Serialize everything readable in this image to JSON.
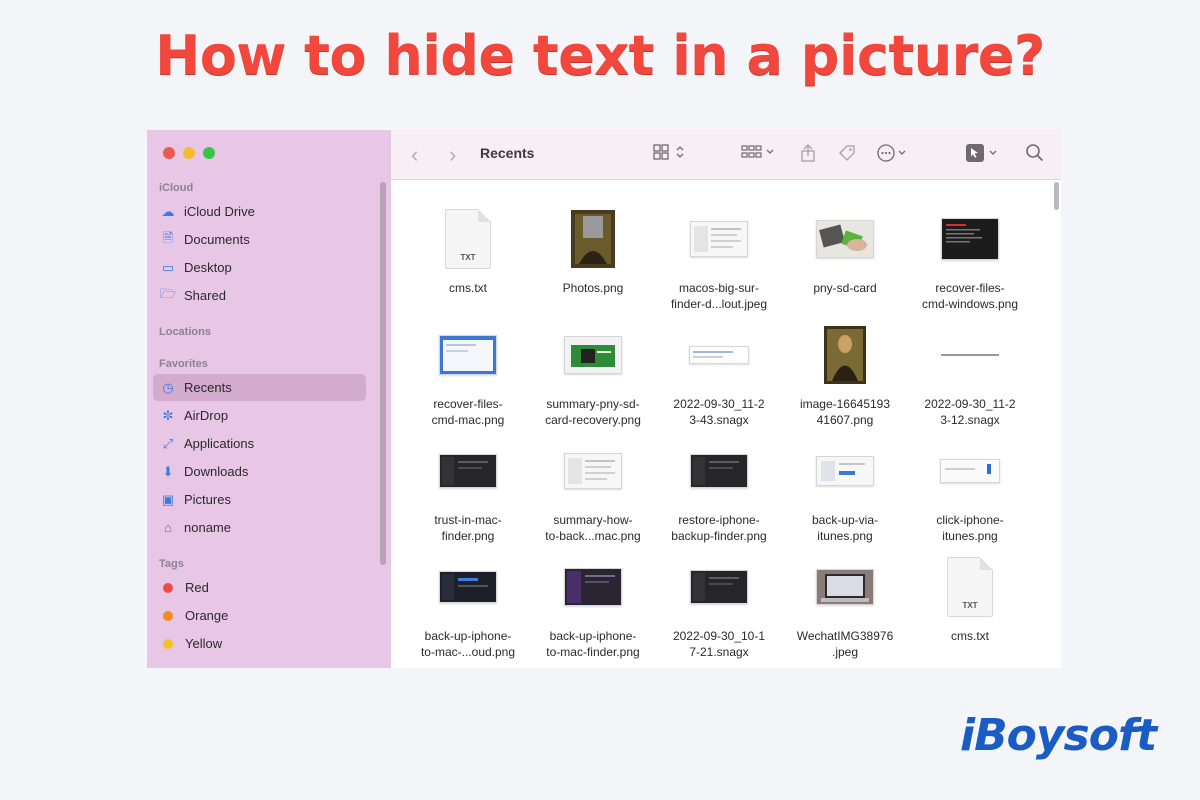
{
  "headline": "How to hide text in a picture?",
  "brand": "iBoysoft",
  "sidebar": {
    "sections": {
      "icloud": "iCloud",
      "locations": "Locations",
      "favorites": "Favorites",
      "tags": "Tags"
    },
    "icloud_items": [
      {
        "label": "iCloud Drive",
        "icon": "cloud-icon"
      },
      {
        "label": "Documents",
        "icon": "document-icon"
      },
      {
        "label": "Desktop",
        "icon": "desktop-icon"
      },
      {
        "label": "Shared",
        "icon": "shared-folder-icon"
      }
    ],
    "favorite_items": [
      {
        "label": "Recents",
        "icon": "clock-icon",
        "active": true
      },
      {
        "label": "AirDrop",
        "icon": "airdrop-icon"
      },
      {
        "label": "Applications",
        "icon": "applications-icon"
      },
      {
        "label": "Downloads",
        "icon": "download-icon"
      },
      {
        "label": "Pictures",
        "icon": "pictures-icon"
      },
      {
        "label": "noname",
        "icon": "home-icon"
      }
    ],
    "tag_items": [
      {
        "label": "Red",
        "color": "#ee4a48"
      },
      {
        "label": "Orange",
        "color": "#f08a24"
      },
      {
        "label": "Yellow",
        "color": "#f3c121"
      }
    ]
  },
  "toolbar": {
    "title": "Recents"
  },
  "files": [
    {
      "line1": "cms.txt",
      "line2": "",
      "kind": "txt"
    },
    {
      "line1": "Photos.png",
      "line2": "",
      "kind": "mona-gray"
    },
    {
      "line1": "macos-big-sur-",
      "line2": "finder-d...lout.jpeg",
      "kind": "light"
    },
    {
      "line1": "pny-sd-card",
      "line2": "",
      "kind": "sdcard"
    },
    {
      "line1": "recover-files-",
      "line2": "cmd-windows.png",
      "kind": "dark-red"
    },
    {
      "line1": "recover-files-",
      "line2": "cmd-mac.png",
      "kind": "blue"
    },
    {
      "line1": "summary-pny-sd-",
      "line2": "card-recovery.png",
      "kind": "green"
    },
    {
      "line1": "2022-09-30_11-2",
      "line2": "3-43.snagx",
      "kind": "strip"
    },
    {
      "line1": "image-16645193",
      "line2": "41607.png",
      "kind": "mona"
    },
    {
      "line1": "2022-09-30_11-2",
      "line2": "3-12.snagx",
      "kind": "line"
    },
    {
      "line1": "trust-in-mac-",
      "line2": "finder.png",
      "kind": "dark"
    },
    {
      "line1": "summary-how-",
      "line2": "to-back...mac.png",
      "kind": "light"
    },
    {
      "line1": "restore-iphone-",
      "line2": "backup-finder.png",
      "kind": "dark"
    },
    {
      "line1": "back-up-via-",
      "line2": "itunes.png",
      "kind": "itunes"
    },
    {
      "line1": "click-iphone-",
      "line2": "itunes.png",
      "kind": "itunes2"
    },
    {
      "line1": "back-up-iphone-",
      "line2": "to-mac-...oud.png",
      "kind": "dark-blue"
    },
    {
      "line1": "back-up-iphone-",
      "line2": "to-mac-finder.png",
      "kind": "dark-purple"
    },
    {
      "line1": "2022-09-30_10-1",
      "line2": "7-21.snagx",
      "kind": "dark"
    },
    {
      "line1": "WechatIMG38976",
      "line2": ".jpeg",
      "kind": "laptop"
    },
    {
      "line1": "cms.txt",
      "line2": "",
      "kind": "txt"
    }
  ]
}
